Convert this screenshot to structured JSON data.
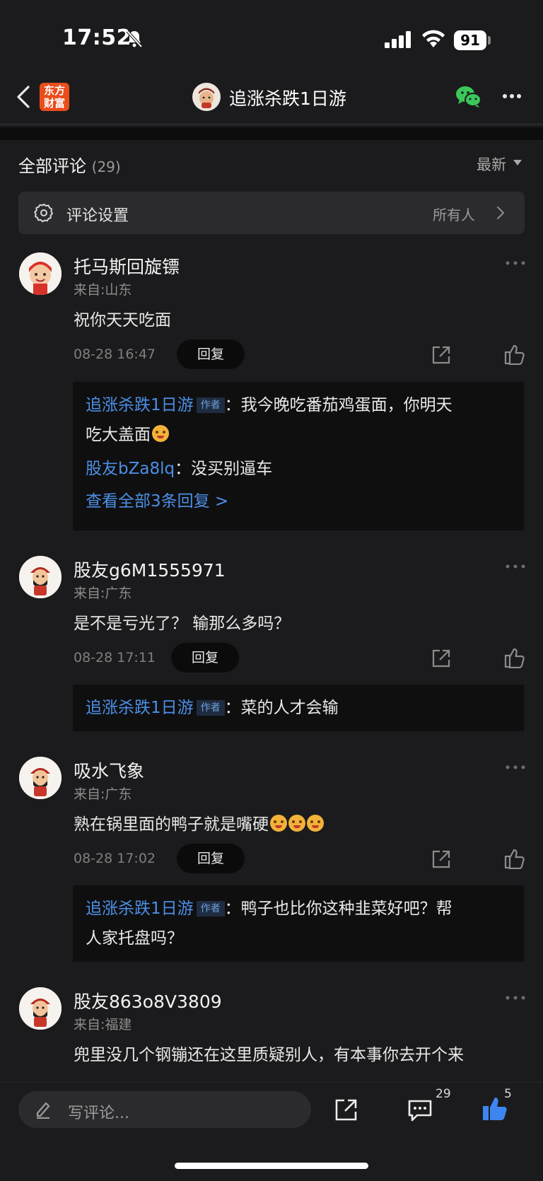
{
  "status_bar": {
    "time": "17:52",
    "battery": "91"
  },
  "nav": {
    "logo_line1": "东方",
    "logo_line2": "财富",
    "title": "追涨杀跌1日游"
  },
  "section": {
    "title": "全部评论",
    "count": "(29)",
    "sort": "最新"
  },
  "settings": {
    "label": "评论设置",
    "value": "所有人"
  },
  "comments": [
    {
      "user": "托马斯回旋镖",
      "location": "来自:山东",
      "content": "祝你天天吃面",
      "time": "08-28 16:47",
      "reply_label": "回复",
      "replies": [
        {
          "user": "追涨杀跌1日游",
          "tag": "作者",
          "sep": "：",
          "text": "我今晚吃番茄鸡蛋面，你明天",
          "text2": "吃大盖面"
        },
        {
          "user": "股友bZa8lq",
          "sep": "：",
          "text": "没买别逼车"
        }
      ],
      "view_all": "查看全部3条回复 >"
    },
    {
      "user": "股友g6M1555971",
      "location": "来自:广东",
      "content": "是不是亏光了？  输那么多吗？",
      "time": "08-28 17:11",
      "reply_label": "回复",
      "replies": [
        {
          "user": "追涨杀跌1日游",
          "tag": "作者",
          "sep": "：",
          "text": "菜的人才会输"
        }
      ]
    },
    {
      "user": "吸水飞象",
      "location": "来自:广东",
      "content": "熟在锅里面的鸭子就是嘴硬",
      "time": "08-28 17:02",
      "reply_label": "回复",
      "replies": [
        {
          "user": "追涨杀跌1日游",
          "tag": "作者",
          "sep": "：",
          "text": "鸭子也比你这种韭菜好吧？帮",
          "text2": "人家托盘吗？"
        }
      ]
    },
    {
      "user": "股友863o8V3809",
      "location": "来自:福建",
      "content": "兜里没几个钢镚还在这里质疑别人，有本事你去开个来"
    }
  ],
  "bottom_bar": {
    "placeholder": "写评论...",
    "comment_count": "29",
    "like_count": "5"
  },
  "colors": {
    "background": "#1b1b1d",
    "link_blue": "#4c8fe6",
    "brand_orange": "#ea4d1c",
    "wechat_green": "#3bc75a"
  },
  "icons": [
    "back-icon",
    "wechat-icon",
    "more-icon",
    "gear-icon",
    "chevron-right-icon",
    "share-icon",
    "like-icon",
    "edit-icon",
    "comment-icon"
  ]
}
